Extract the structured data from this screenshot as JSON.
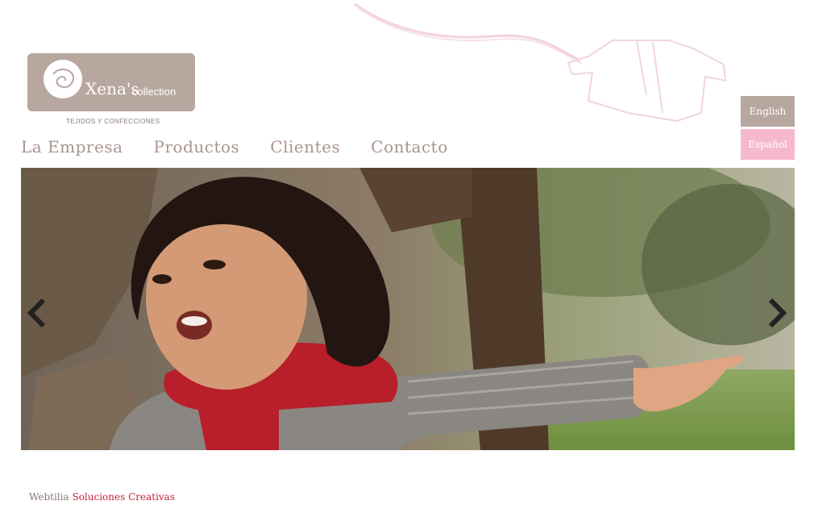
{
  "brand": {
    "name": "Xena's",
    "collection": "collection",
    "tagline": "TEJIDOS Y CONFECCIONES"
  },
  "nav": {
    "items": [
      {
        "label": "La Empresa"
      },
      {
        "label": "Productos"
      },
      {
        "label": "Clientes"
      },
      {
        "label": "Contacto"
      }
    ]
  },
  "language": {
    "english": "English",
    "spanish": "Español"
  },
  "slider": {
    "image": "girl-red-scarf-photo",
    "prev_icon": "chevron-left-icon",
    "next_icon": "chevron-right-icon"
  },
  "footer": {
    "company": "Webtilia",
    "slogan": "Soluciones Creativas"
  },
  "colors": {
    "brand_taupe": "#b8a79f",
    "brand_pink": "#f6b9cc",
    "nav_text": "#a89490",
    "footer_accent": "#c8213a"
  }
}
